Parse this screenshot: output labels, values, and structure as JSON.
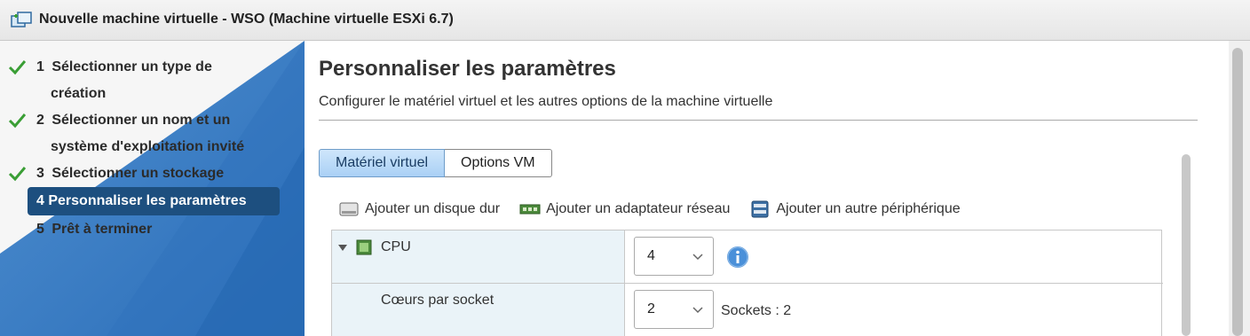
{
  "window": {
    "title": "Nouvelle machine virtuelle - WSO (Machine virtuelle ESXi 6.7)"
  },
  "steps": [
    {
      "num": "1",
      "line1": "Sélectionner un type de",
      "line2": "création",
      "done": true
    },
    {
      "num": "2",
      "line1": "Sélectionner un nom et un",
      "line2": "système d'exploitation invité",
      "done": true
    },
    {
      "num": "3",
      "line1": "Sélectionner un stockage",
      "done": true
    },
    {
      "num": "4",
      "line1": "Personnaliser les paramètres",
      "active": true
    },
    {
      "num": "5",
      "line1": "Prêt à terminer"
    }
  ],
  "main": {
    "title": "Personnaliser les paramètres",
    "subtitle": "Configurer le matériel virtuel et les autres options de la machine virtuelle",
    "tabs": [
      {
        "label": "Matériel virtuel",
        "active": true
      },
      {
        "label": "Options VM",
        "active": false
      }
    ],
    "toolbar": {
      "add_disk": "Ajouter un disque dur",
      "add_network": "Ajouter un adaptateur réseau",
      "add_other": "Ajouter un autre périphérique"
    },
    "hardware": {
      "cpu_label": "CPU",
      "cpu_value": "4",
      "cores_label": "Cœurs par socket",
      "cores_value": "2",
      "sockets_text": "Sockets : 2"
    }
  },
  "colors": {
    "accent": "#1d4f7f",
    "check": "#3a9e35",
    "info": "#4a90d9"
  },
  "icons": {
    "title": "wizard-vm-icon",
    "steps": "checkmark-icon",
    "disk": "hard-disk-icon",
    "network": "network-adapter-icon",
    "other": "device-icon",
    "cpu": "cpu-chip-icon",
    "info": "info-icon"
  }
}
